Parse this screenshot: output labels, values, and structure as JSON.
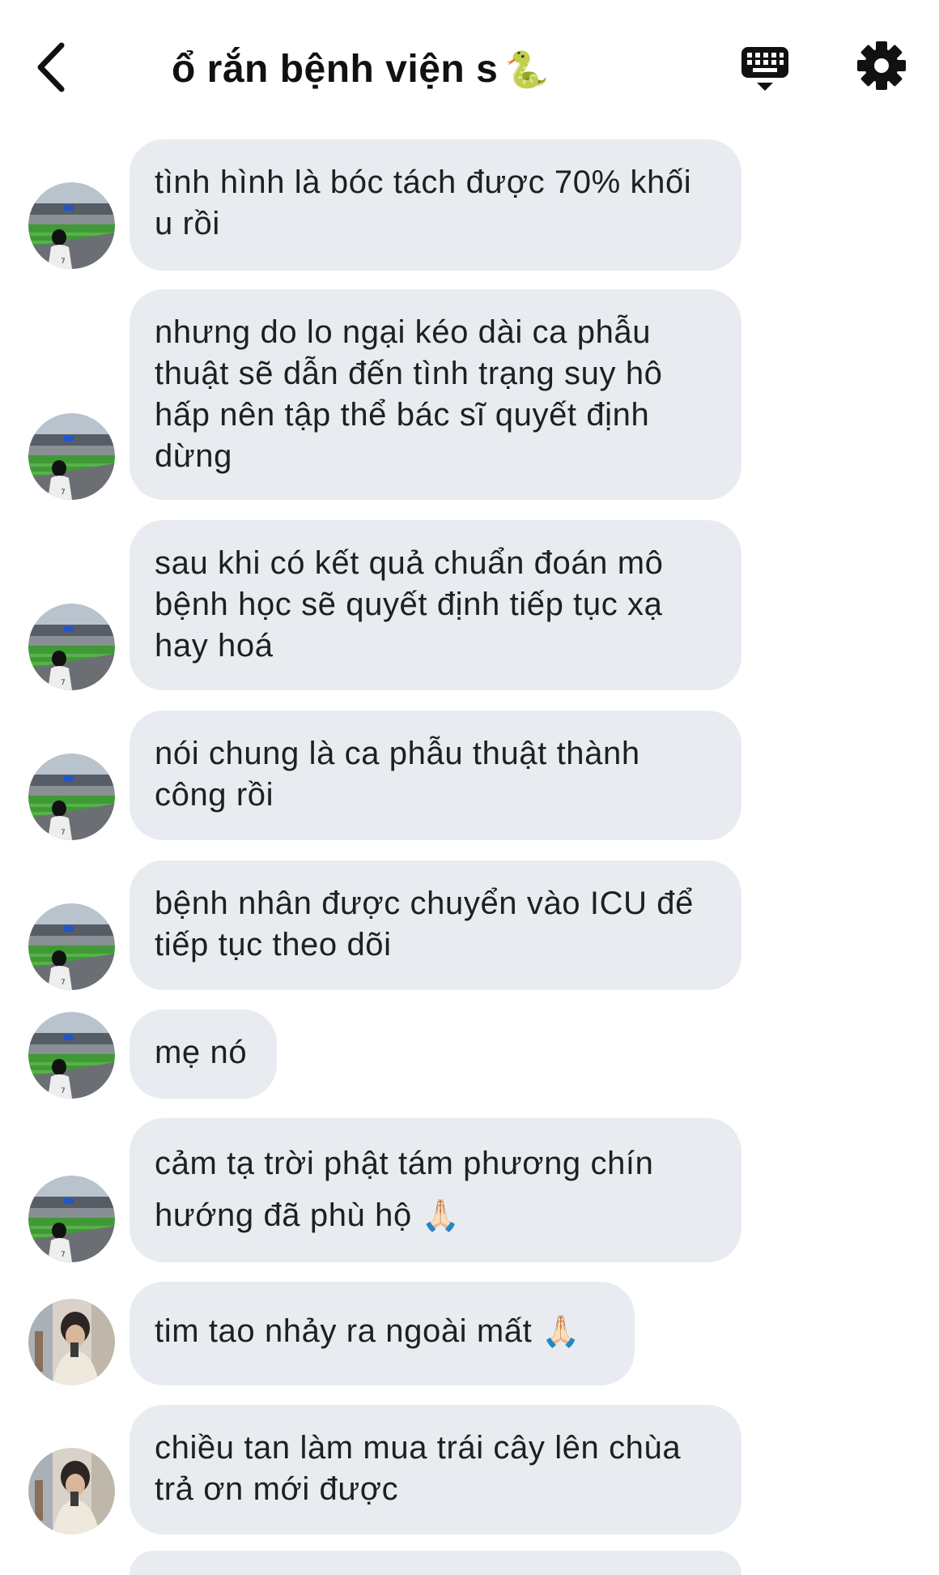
{
  "header": {
    "title": "ổ rắn bệnh viện s",
    "title_emoji": "🐍"
  },
  "messages": [
    {
      "text": "tình hình là bóc tách được 70% khối u rồi",
      "avatar": "stadium"
    },
    {
      "text": "nhưng do lo ngại kéo dài ca phẫu thuật sẽ dẫn đến tình trạng suy hô hấp nên tập thể bác sĩ quyết định dừng",
      "avatar": "stadium"
    },
    {
      "text": "sau khi có kết quả chuẩn đoán mô bệnh học sẽ quyết định tiếp tục xạ hay hoá",
      "avatar": "stadium"
    },
    {
      "text": "nói chung là ca phẫu thuật thành công rồi",
      "avatar": "stadium"
    },
    {
      "text": "bệnh nhân được chuyển vào ICU để tiếp tục theo dõi",
      "avatar": "stadium"
    },
    {
      "text": "mẹ nó",
      "avatar": "stadium"
    },
    {
      "text": "cảm tạ trời phật tám phương chín hướng đã phù hộ",
      "emoji": "🙏🏻",
      "avatar": "stadium"
    },
    {
      "text": "tim tao nhảy ra ngoài mất",
      "emoji": "🙏🏻",
      "avatar": "person"
    },
    {
      "text": "chiều tan làm mua trái cây lên chùa trả ơn mới được",
      "avatar": "person"
    }
  ],
  "icons": {
    "back": "chevron-left-icon",
    "keyboard": "keyboard-icon",
    "settings": "gear-icon"
  },
  "colors": {
    "bubble": "#e8ebf0",
    "background": "#ffffff",
    "text": "#1f1f1f"
  }
}
